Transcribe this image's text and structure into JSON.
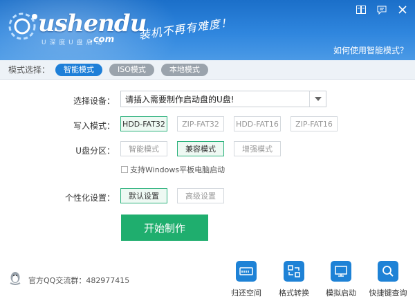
{
  "header": {
    "logo_text": "ushendu",
    "logo_sub": "U 深 度 U 盘 启 动",
    "logo_com": ".com",
    "slogan": "装机不再有难度！",
    "help_link": "如何使用智能模式？",
    "controls": [
      "book-icon",
      "chat-icon",
      "close-icon"
    ]
  },
  "mode_bar": {
    "label": "模式选择：",
    "tabs": [
      {
        "label": "智能模式",
        "active": true
      },
      {
        "label": "ISO模式",
        "active": false
      },
      {
        "label": "本地模式",
        "active": false
      }
    ]
  },
  "form": {
    "device": {
      "label": "选择设备：",
      "value": "请插入需要制作启动盘的U盘!"
    },
    "write_mode": {
      "label": "写入模式：",
      "options": [
        "HDD-FAT32",
        "ZIP-FAT32",
        "HDD-FAT16",
        "ZIP-FAT16"
      ],
      "selected": "HDD-FAT32"
    },
    "partition": {
      "label": "U盘分区：",
      "options": [
        "智能模式",
        "兼容模式",
        "增强模式"
      ],
      "selected": "兼容模式"
    },
    "windows_tablet": {
      "label": "支持Windows平板电脑启动",
      "checked": false
    },
    "personalize": {
      "label": "个性化设置：",
      "options": [
        "默认设置",
        "高级设置"
      ],
      "selected": "默认设置"
    },
    "start_button": "开始制作"
  },
  "footer": {
    "qq_group": "官方QQ交流群：482977415",
    "tools": [
      {
        "label": "归还空间",
        "icon": "disk-icon"
      },
      {
        "label": "格式转换",
        "icon": "convert-icon"
      },
      {
        "label": "模拟启动",
        "icon": "monitor-icon"
      },
      {
        "label": "快捷键查询",
        "icon": "search-icon"
      }
    ]
  },
  "colors": {
    "header_blue": "#2f86de",
    "active_tab": "#1e7fd8",
    "accent_green": "#1fae6e",
    "tool_blue": "#1e82d6"
  }
}
